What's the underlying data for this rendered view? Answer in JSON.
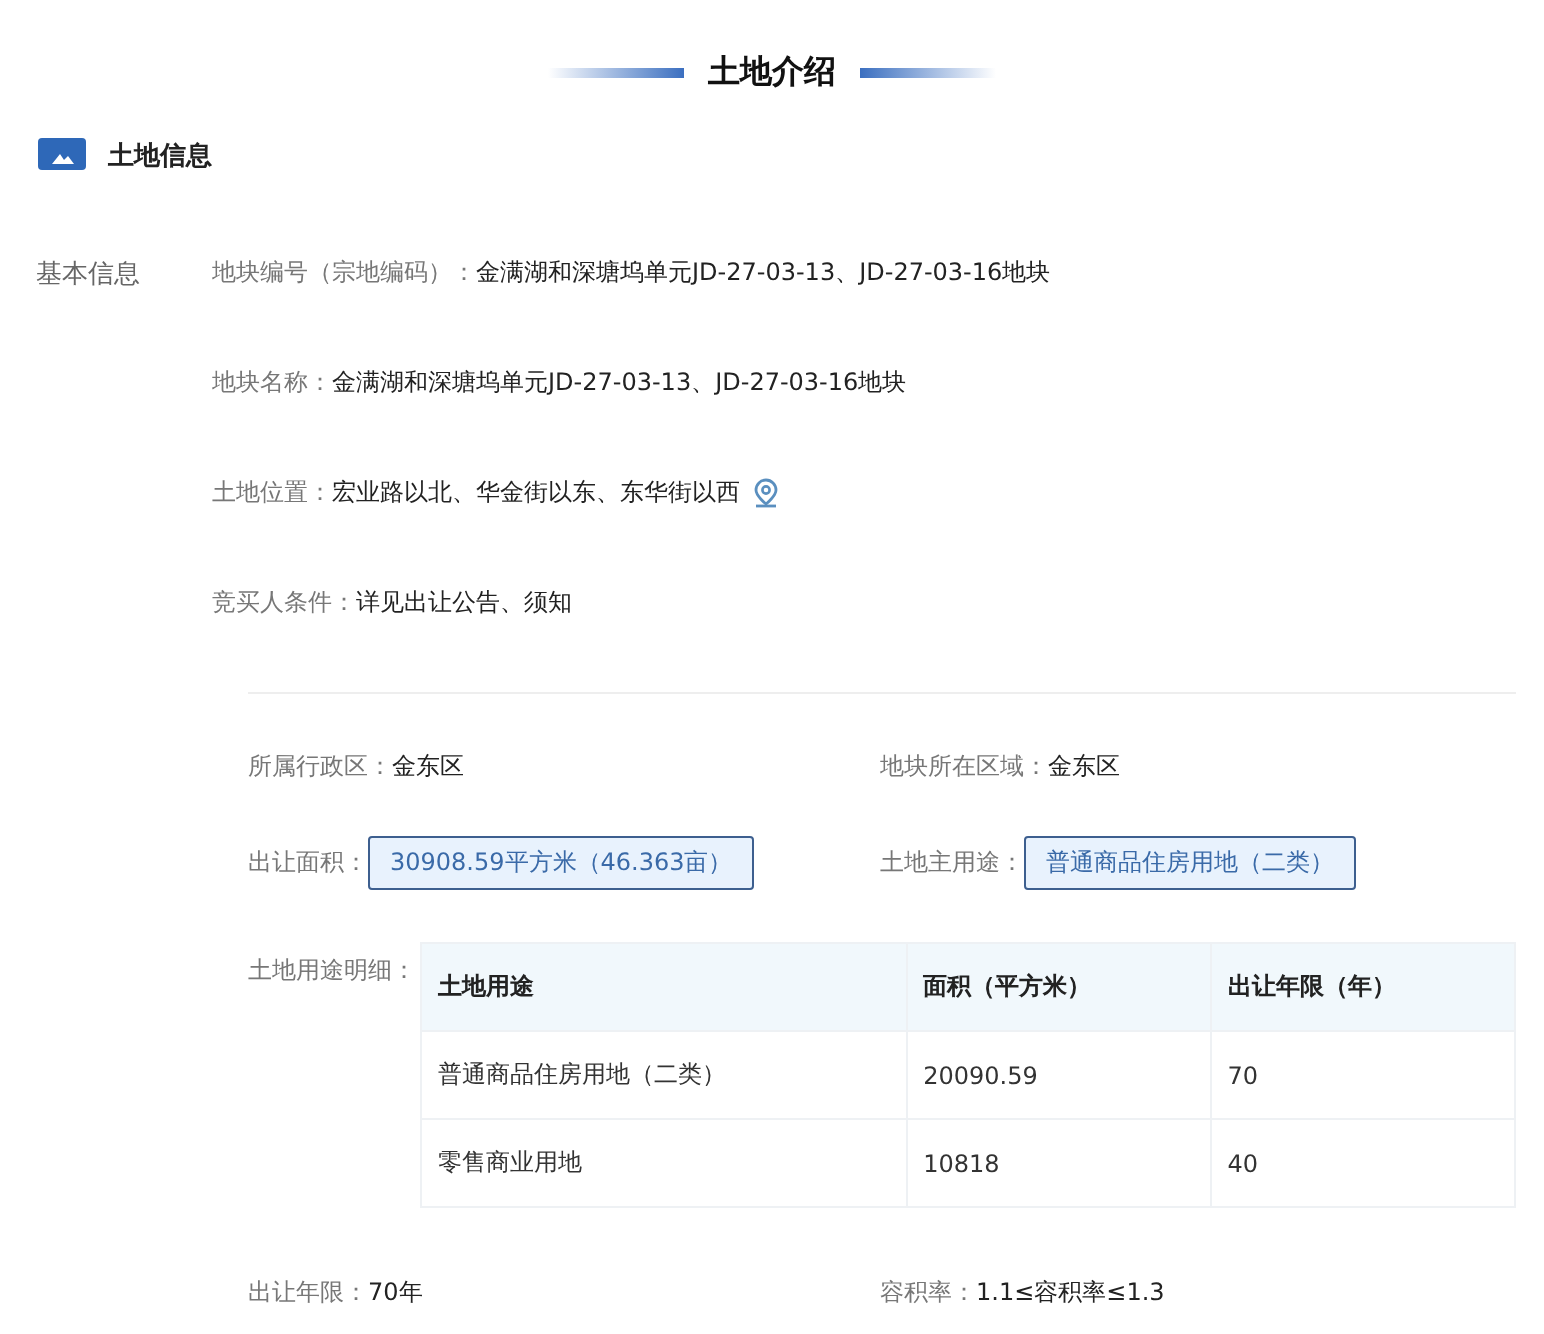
{
  "title": "土地介绍",
  "section": {
    "title": "土地信息"
  },
  "basic_info": {
    "label": "基本信息",
    "fields": [
      {
        "label": "地块编号（宗地编码）：",
        "value": "金满湖和深塘坞单元JD-27-03-13、JD-27-03-16地块",
        "kind": "text"
      },
      {
        "label": "地块名称：",
        "value": "金满湖和深塘坞单元JD-27-03-13、JD-27-03-16地块",
        "kind": "text"
      },
      {
        "label": "土地位置：",
        "value": "宏业路以北、华金街以东、东华街以西",
        "kind": "location"
      },
      {
        "label": "竞买人条件：",
        "value": "详见出让公告、须知",
        "kind": "text"
      }
    ]
  },
  "details": [
    {
      "label": "所属行政区：",
      "value": "金东区",
      "kind": "text"
    },
    {
      "label": "地块所在区域：",
      "value": "金东区",
      "kind": "text"
    },
    {
      "label": "出让面积：",
      "value": "30908.59平方米（46.363亩）",
      "kind": "tag"
    },
    {
      "label": "土地主用途：",
      "value": "普通商品住房用地（二类）",
      "kind": "tag"
    }
  ],
  "land_use": {
    "label": "土地用途明细：",
    "columns": [
      "土地用途",
      "面积（平方米）",
      "出让年限（年）"
    ],
    "rows": [
      [
        "普通商品住房用地（二类）",
        "20090.59",
        "70"
      ],
      [
        "零售商业用地",
        "10818",
        "40"
      ]
    ]
  },
  "terms": [
    {
      "label": "出让年限：",
      "value": "70年",
      "kind": "text"
    },
    {
      "label": "容积率：",
      "value": "1.1≤容积率≤1.3",
      "kind": "text"
    }
  ]
}
